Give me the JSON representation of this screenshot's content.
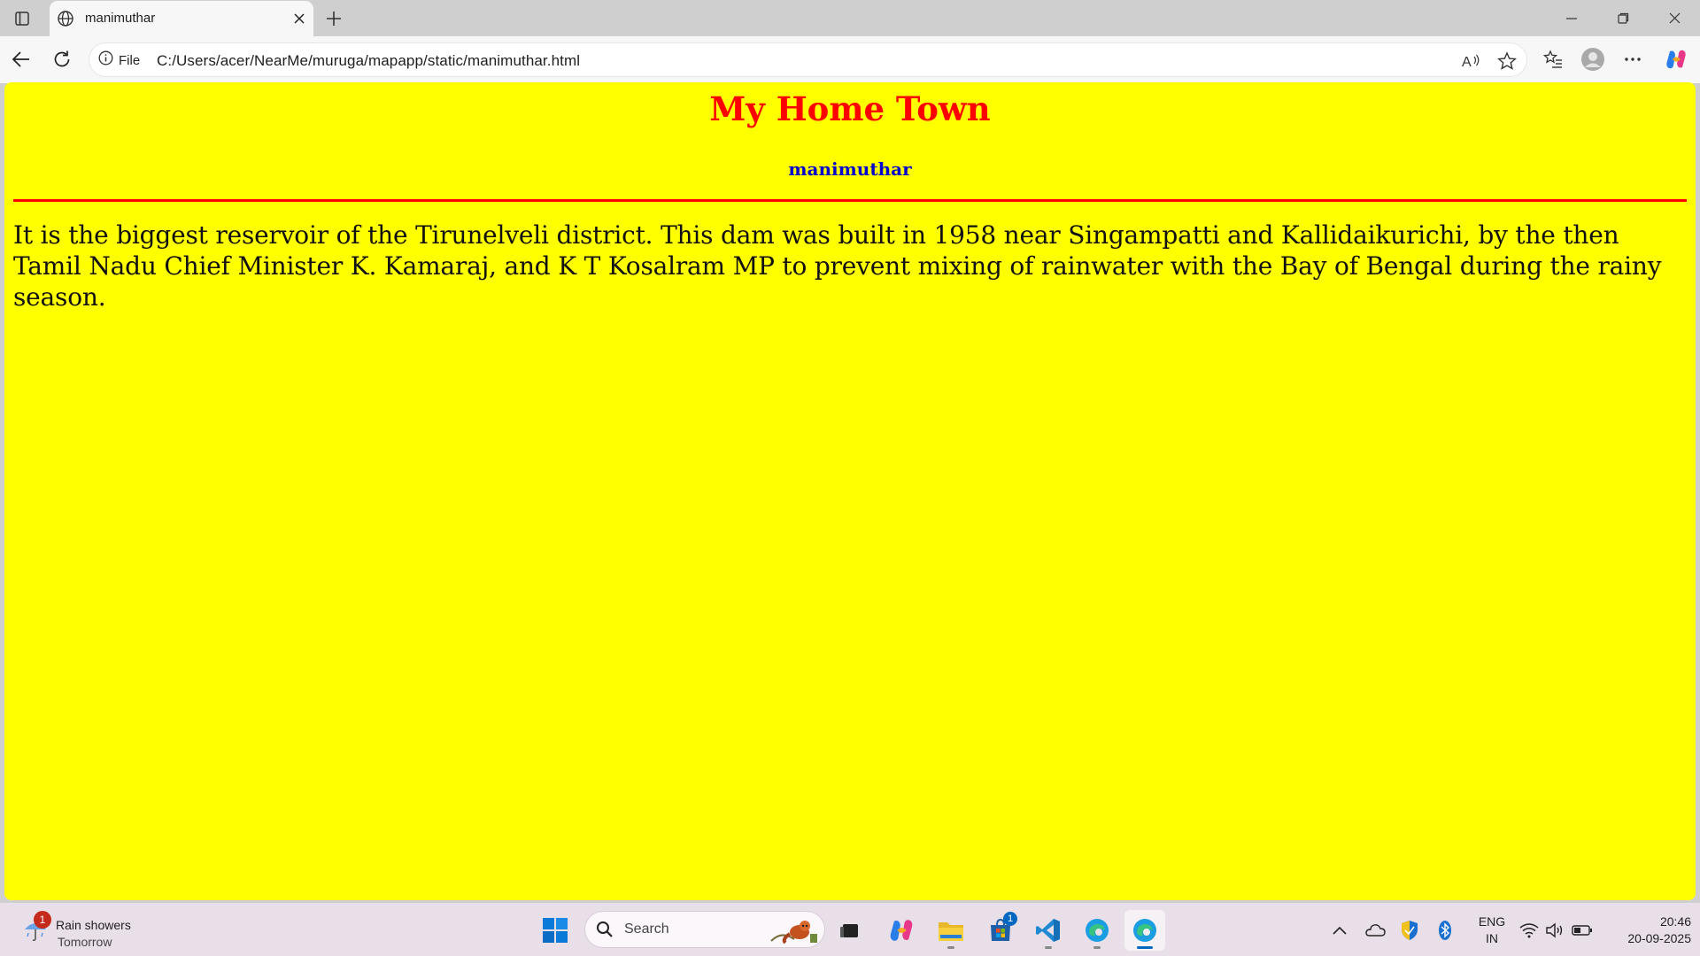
{
  "browser": {
    "tab": {
      "title": "manimuthar"
    },
    "address": {
      "site_info_label": "File",
      "url": "C:/Users/acer/NearMe/muruga/mapapp/static/manimuthar.html"
    }
  },
  "page": {
    "heading": "My Home Town",
    "subheading": "manimuthar",
    "paragraph": "It is the biggest reservoir of the Tirunelveli district. This dam was built in 1958 near Singampatti and Kallidaikurichi, by the then Tamil Nadu Chief Minister K. Kamaraj, and K T Kosalram MP to prevent mixing of rainwater with the Bay of Bengal during the rainy season.",
    "colors": {
      "background": "#ffff00",
      "heading": "#ff0000",
      "subheading": "#0000cc",
      "rule": "#ff0000"
    }
  },
  "taskbar": {
    "weather": {
      "title": "Rain showers",
      "subtitle": "Tomorrow",
      "badge": "1",
      "icon": "umbrella-rain-icon"
    },
    "search_label": "Search",
    "store_badge": "1",
    "apps": [
      "windows-start-icon",
      "task-view-icon",
      "copilot-icon",
      "file-explorer-icon",
      "microsoft-store-icon",
      "vscode-icon",
      "edge-icon",
      "edge-active-icon"
    ],
    "tray": [
      "chevron-up-icon",
      "onedrive-cloud-icon",
      "windows-security-icon",
      "bluetooth-icon",
      "wifi-icon",
      "volume-icon",
      "battery-icon"
    ],
    "language": {
      "line1": "ENG",
      "line2": "IN"
    },
    "clock": {
      "time": "20:46",
      "date": "20-09-2025"
    }
  }
}
